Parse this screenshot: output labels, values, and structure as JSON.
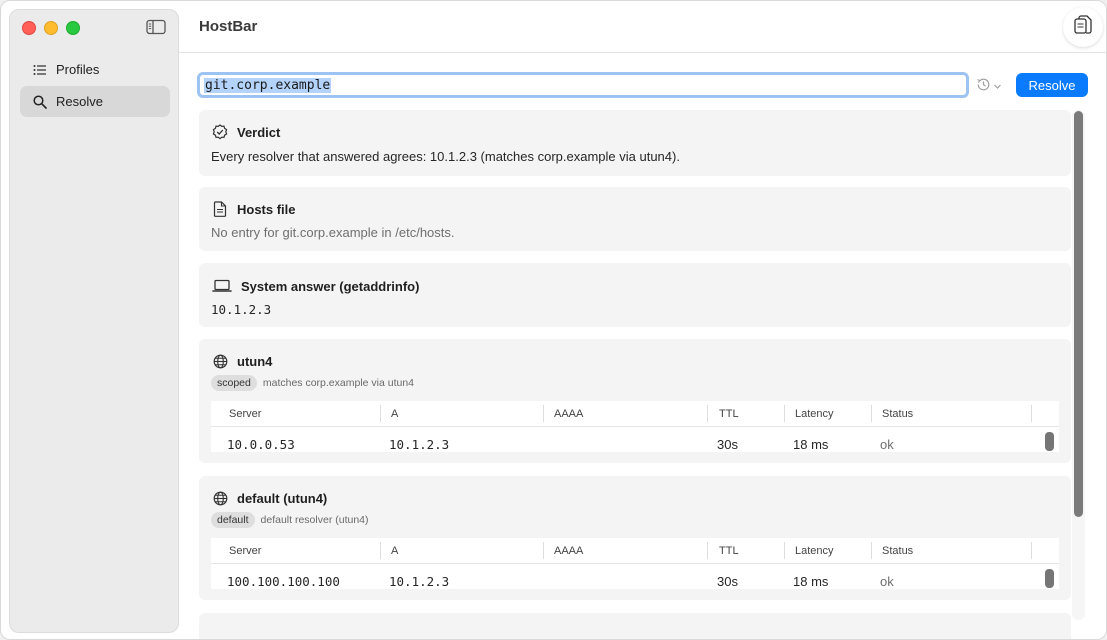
{
  "app": {
    "title": "HostBar"
  },
  "sidebar": {
    "items": [
      {
        "label": "Profiles",
        "icon": "list-icon",
        "active": false
      },
      {
        "label": "Resolve",
        "icon": "magnifier-icon",
        "active": true
      }
    ]
  },
  "search": {
    "value": "git.corp.example"
  },
  "toolbar": {
    "resolve_label": "Resolve"
  },
  "colors": {
    "accent": "#0a7aff",
    "selection": "#b3d3fb",
    "close": "#ff5f57",
    "minimize": "#febc2e",
    "zoom": "#28c840"
  },
  "verdict": {
    "title": "Verdict",
    "text": "Every resolver that answered agrees: 10.1.2.3 (matches corp.example via utun4)."
  },
  "hosts_file": {
    "title": "Hosts file",
    "text": "No entry for git.corp.example in /etc/hosts."
  },
  "system_answer": {
    "title": "System answer (getaddrinfo)",
    "value": "10.1.2.3"
  },
  "table_headers": [
    "Server",
    "A",
    "AAAA",
    "TTL",
    "Latency",
    "Status"
  ],
  "resolvers": [
    {
      "title": "utun4",
      "tag": "scoped",
      "note": "matches corp.example via utun4",
      "row": {
        "server": "10.0.0.53",
        "a": "10.1.2.3",
        "aaaa": "",
        "ttl": "30s",
        "latency": "18 ms",
        "status": "ok"
      }
    },
    {
      "title": "default (utun4)",
      "tag": "default",
      "note": "default resolver (utun4)",
      "row": {
        "server": "100.100.100.100",
        "a": "10.1.2.3",
        "aaaa": "",
        "ttl": "30s",
        "latency": "18 ms",
        "status": "ok"
      }
    }
  ]
}
